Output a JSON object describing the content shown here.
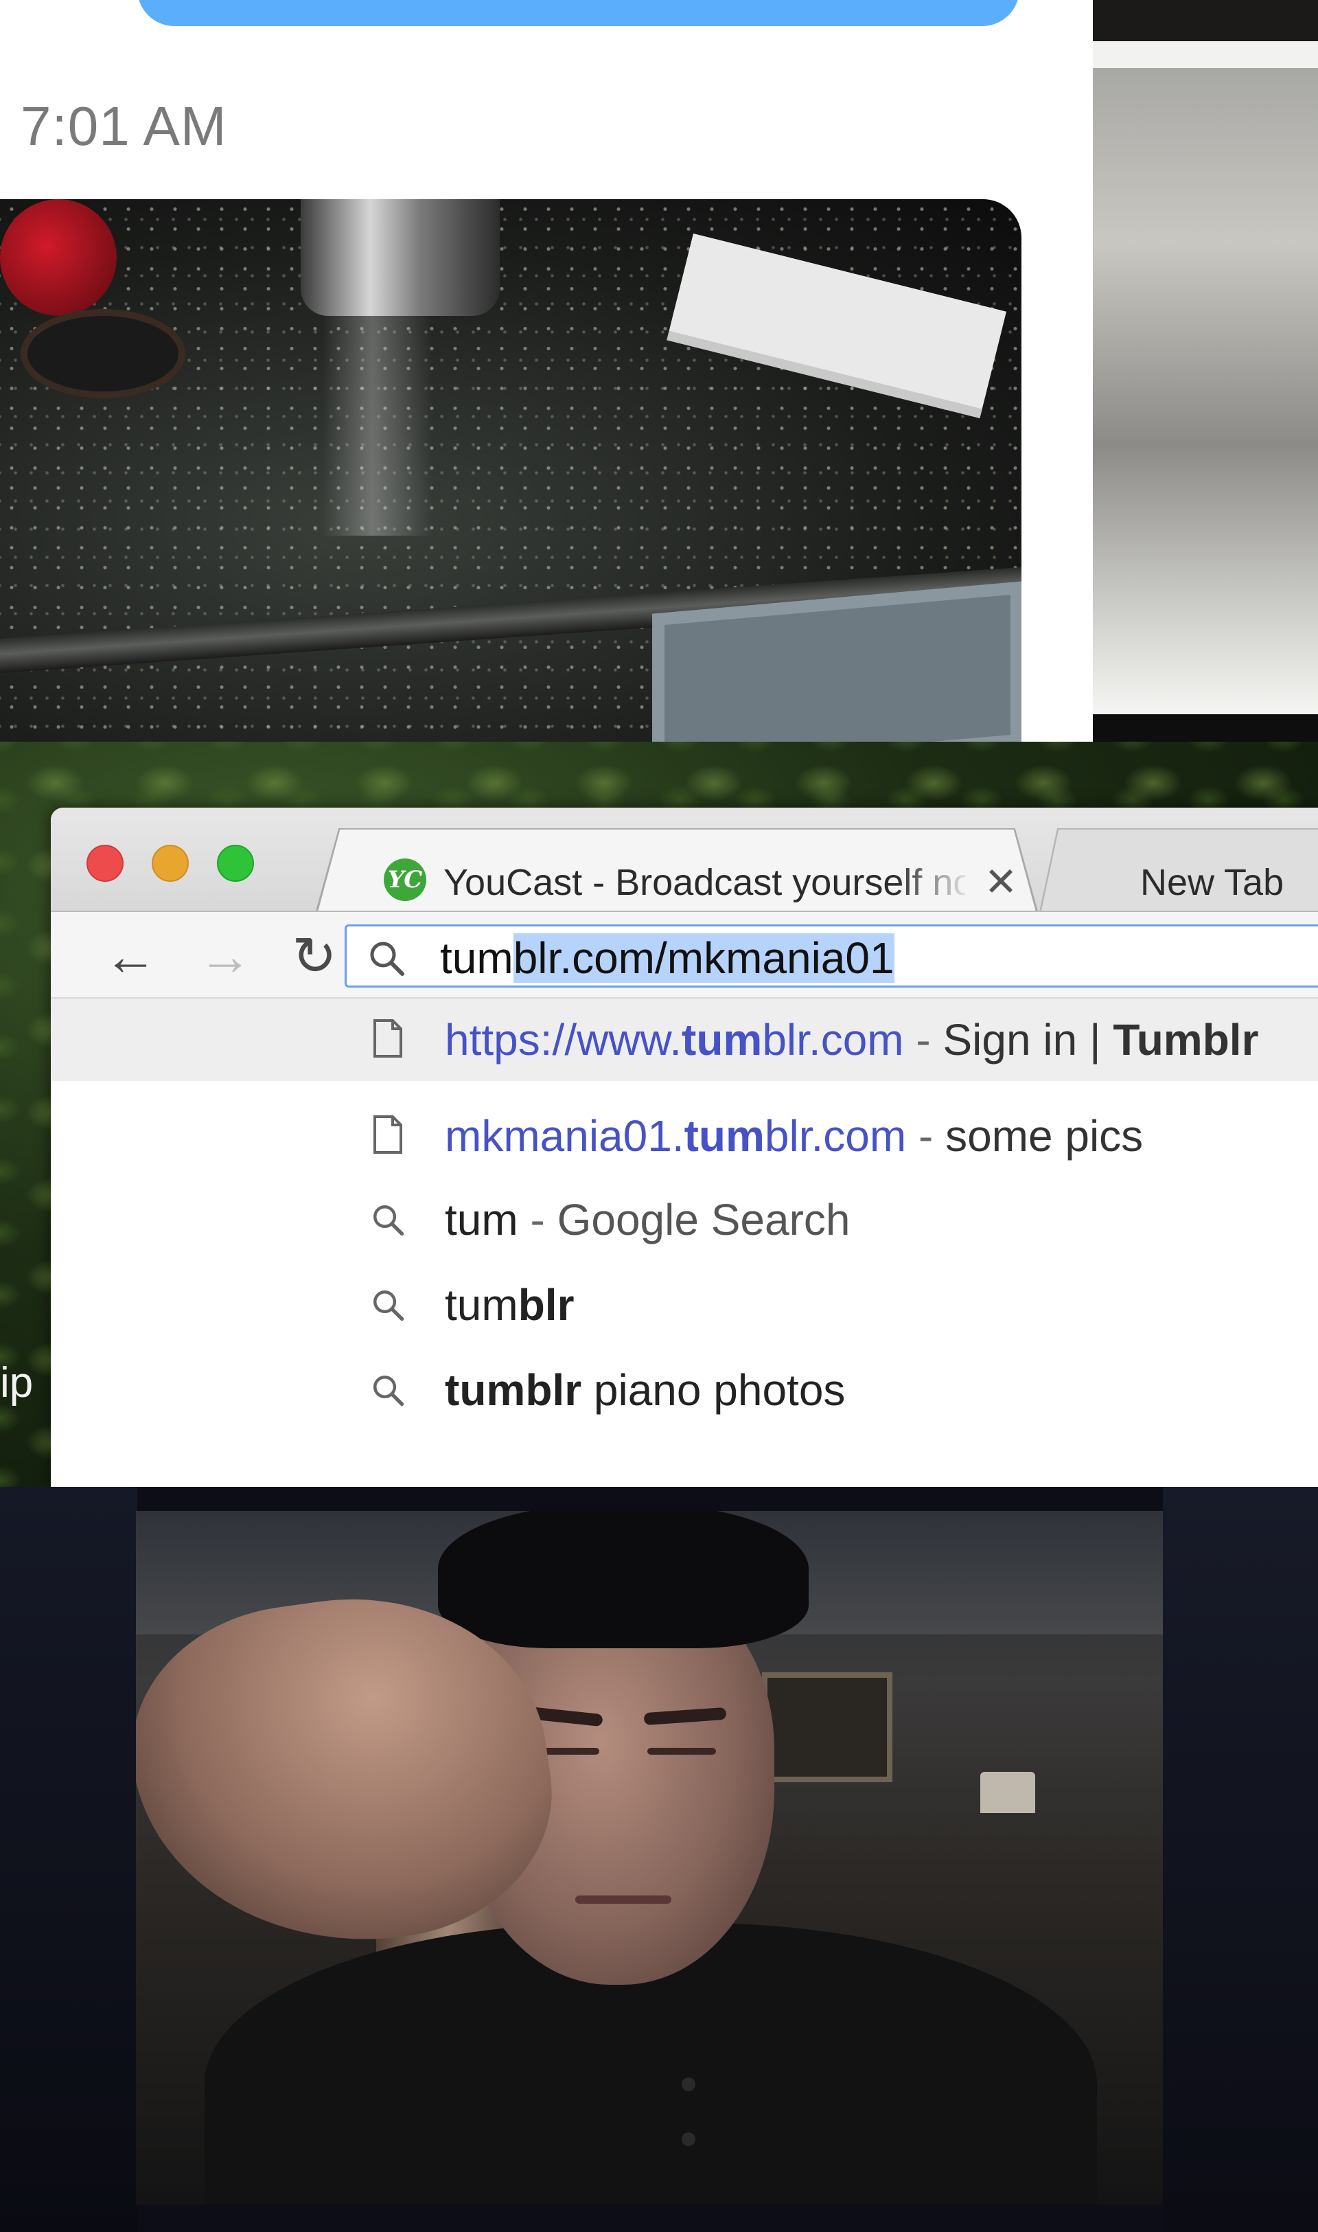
{
  "messages": {
    "timestamp": "7:01 AM"
  },
  "browser": {
    "tabs": [
      {
        "title": "YouCast - Broadcast yourself now",
        "favicon": "YC",
        "active": true
      },
      {
        "title": "New Tab",
        "active": false
      }
    ],
    "omnibox": {
      "typed": "tum",
      "autocompleted": "blr.com/mkmania01"
    },
    "suggestions": [
      {
        "icon": "page-icon",
        "url_pre": "https://www.",
        "url_bold": "tum",
        "url_post": "blr.com",
        "sep": " - ",
        "desc": "Sign in | ",
        "desc_bold": "Tumblr",
        "selected": true
      },
      {
        "icon": "page-icon",
        "url_pre": "mkmania01.",
        "url_bold": "tum",
        "url_post": "blr.com",
        "sep": " - ",
        "desc": "some pics",
        "selected": false
      },
      {
        "icon": "search-icon",
        "text": "tum",
        "sep": " - ",
        "desc": "Google Search",
        "selected": false
      },
      {
        "icon": "search-icon",
        "text": "tum",
        "text_bold": "blr",
        "selected": false
      },
      {
        "icon": "search-icon",
        "text_bold_lead": "tumblr",
        "text_after": " piano photos",
        "selected": false
      }
    ],
    "side_fragment": "ip"
  },
  "colors": {
    "accent_blue": "#5aaefc",
    "link_blue": "#4652c6",
    "omnibox_focus": "#6aa0ea",
    "selection": "#b6d3fb",
    "traffic_close": "#ee4c4c",
    "traffic_minimize": "#e8a530",
    "traffic_maximize": "#2ec338"
  }
}
